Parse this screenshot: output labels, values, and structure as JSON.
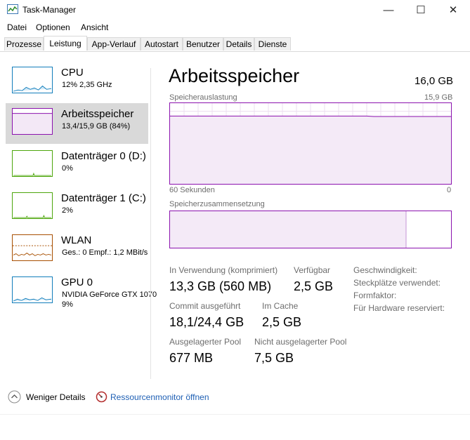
{
  "window": {
    "title": "Task-Manager",
    "controls": {
      "minimize": "—",
      "maximize": "☐",
      "close": "✕"
    }
  },
  "menu": [
    "Datei",
    "Optionen",
    "Ansicht"
  ],
  "tabs": [
    "Prozesse",
    "Leistung",
    "App-Verlauf",
    "Autostart",
    "Benutzer",
    "Details",
    "Dienste"
  ],
  "active_tab": "Leistung",
  "sidebar": [
    {
      "name": "CPU",
      "line1": "12% 2,35 GHz",
      "line2": "",
      "color": "#117dbb"
    },
    {
      "name": "Arbeitsspeicher",
      "line1": "13,4/15,9 GB (84%)",
      "line2": "",
      "color": "#8b12ae"
    },
    {
      "name": "Datenträger 0 (D:)",
      "line1": "0%",
      "line2": "",
      "color": "#4da60c"
    },
    {
      "name": "Datenträger 1 (C:)",
      "line1": "2%",
      "line2": "",
      "color": "#4da60c"
    },
    {
      "name": "WLAN",
      "line1": "Ges.: 0 Empf.: 1,2 MBit/s",
      "line2": "",
      "color": "#a74f01"
    },
    {
      "name": "GPU 0",
      "line1": "NVIDIA GeForce GTX 1070",
      "line2": "9%",
      "color": "#117dbb"
    }
  ],
  "main": {
    "title": "Arbeitsspeicher",
    "total": "16,0 GB",
    "usage_label": "Speicherauslastung",
    "usage_max": "15,9 GB",
    "usage_fraction": 0.84,
    "axis_left": "60 Sekunden",
    "axis_right": "0",
    "composition_label": "Speicherzusammensetzung",
    "composition_in_use_fraction": 0.84,
    "stats": {
      "in_use_label": "In Verwendung (komprimiert)",
      "in_use_value": "13,3 GB (560 MB)",
      "available_label": "Verfügbar",
      "available_value": "2,5 GB",
      "commit_label": "Commit ausgeführt",
      "commit_value": "18,1/24,4 GB",
      "cached_label": "Im Cache",
      "cached_value": "2,5 GB",
      "paged_label": "Ausgelagerter Pool",
      "paged_value": "677 MB",
      "nonpaged_label": "Nicht ausgelagerter Pool",
      "nonpaged_value": "7,5 GB"
    },
    "right_labels": [
      "Geschwindigkeit:",
      "Steckplätze verwendet:",
      "Formfaktor:",
      "Für Hardware reserviert:"
    ]
  },
  "footer": {
    "fewer_details": "Weniger Details",
    "resource_monitor": "Ressourcenmonitor öffnen"
  }
}
